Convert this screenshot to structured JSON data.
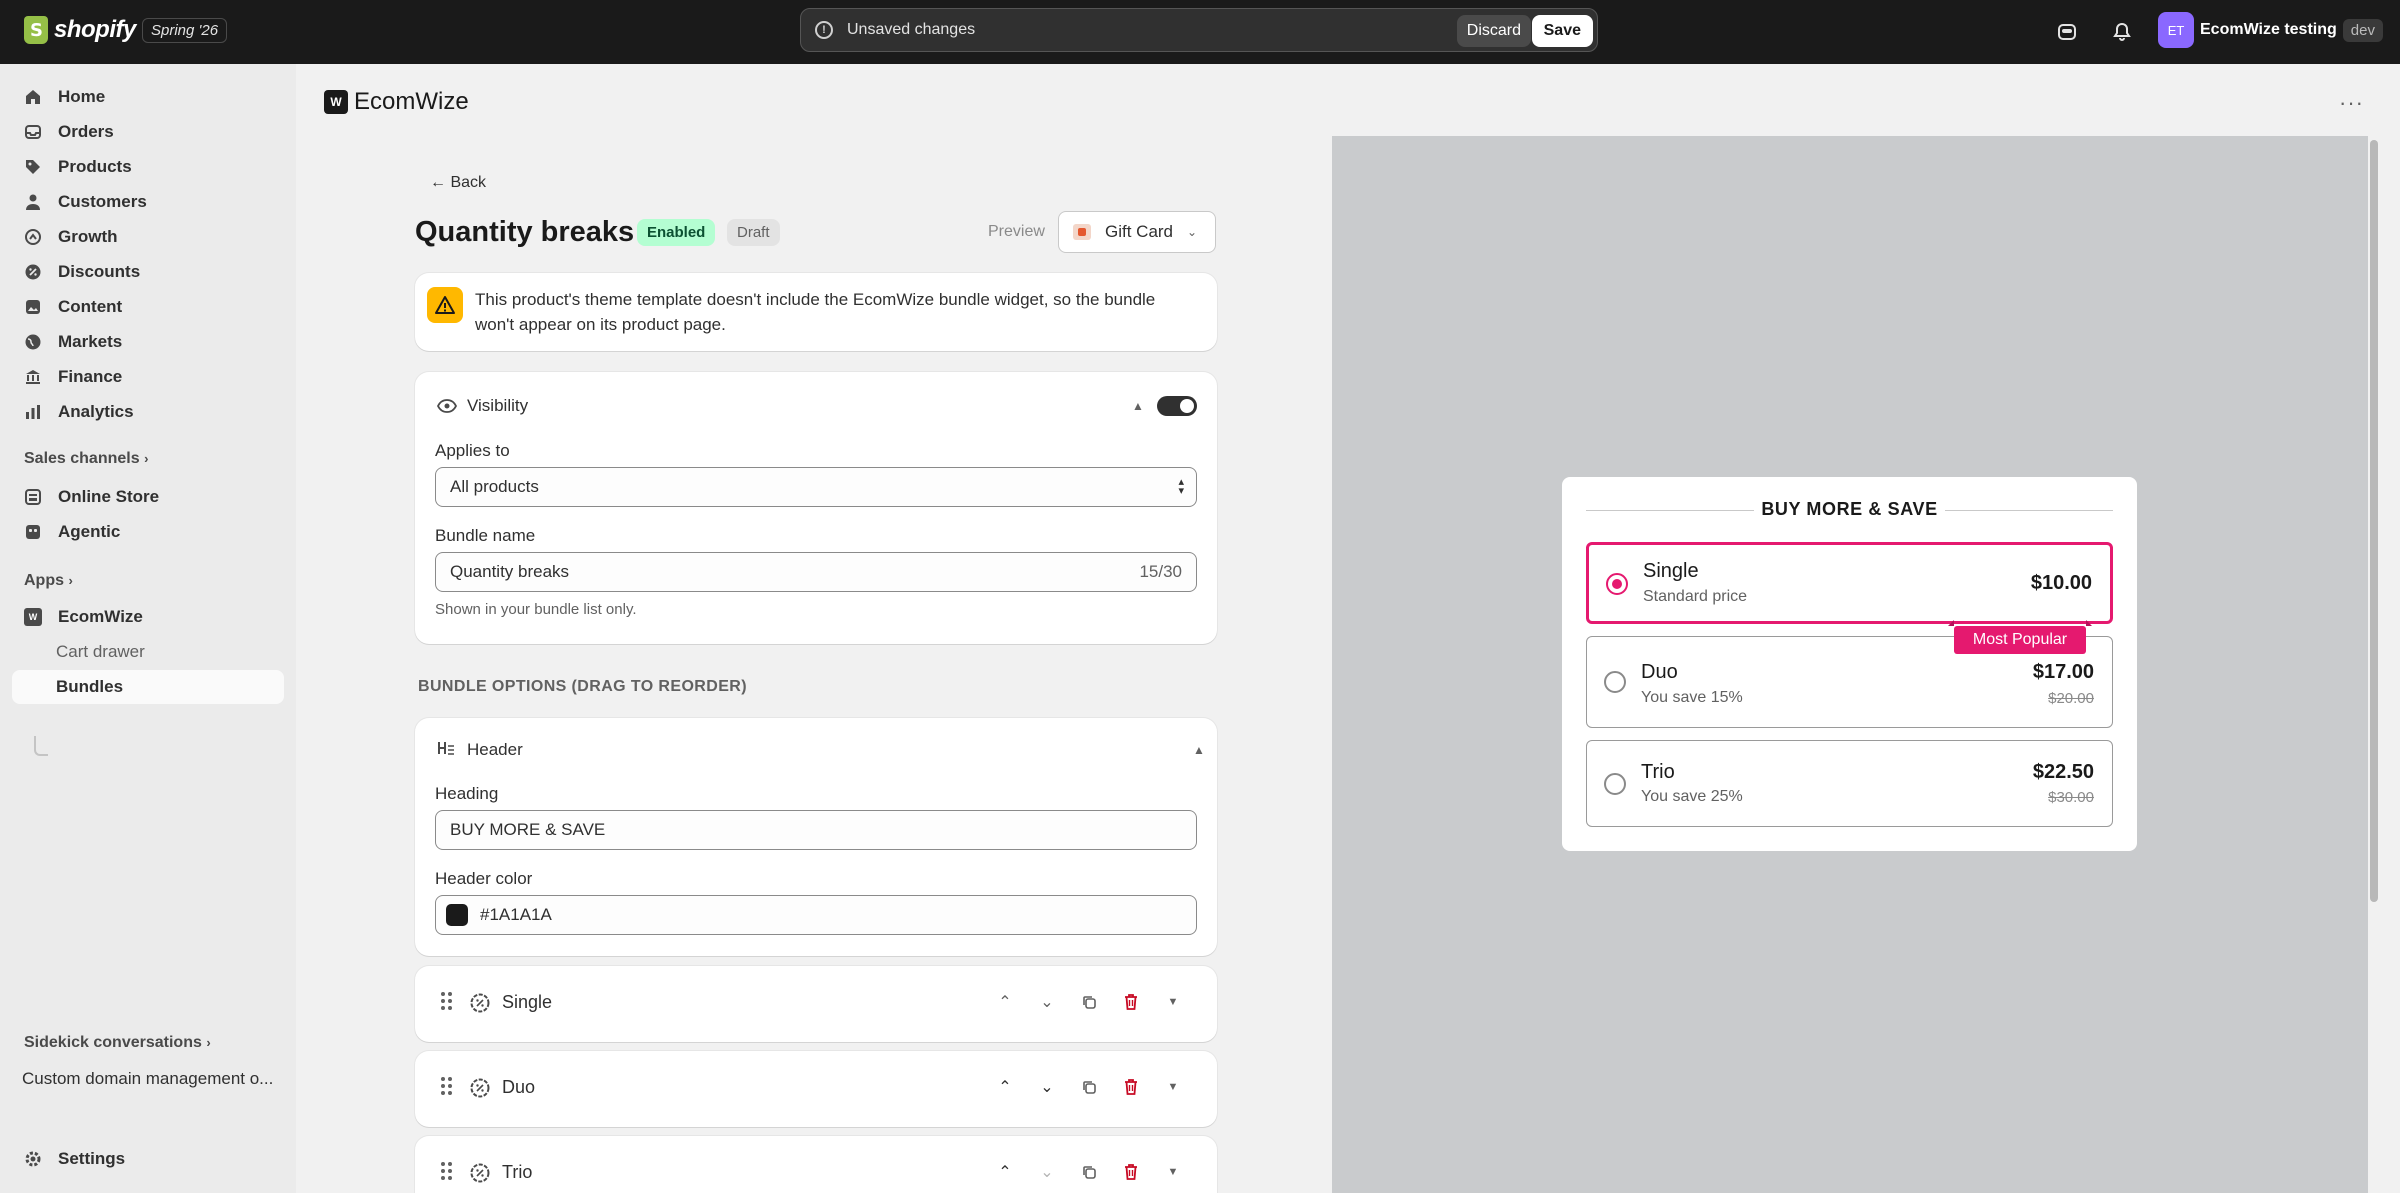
{
  "topbar": {
    "logo_text": "shopify",
    "season": "Spring '26",
    "unsaved_message": "Unsaved changes",
    "discard_label": "Discard",
    "save_label": "Save",
    "avatar_initials": "ET",
    "store_name": "EcomWize testing",
    "store_badge": "dev"
  },
  "sidebar": {
    "items": [
      {
        "label": "Home",
        "icon": "home-icon"
      },
      {
        "label": "Orders",
        "icon": "inbox-icon"
      },
      {
        "label": "Products",
        "icon": "tag-icon"
      },
      {
        "label": "Customers",
        "icon": "person-icon"
      },
      {
        "label": "Growth",
        "icon": "growth-icon"
      },
      {
        "label": "Discounts",
        "icon": "discount-icon"
      },
      {
        "label": "Content",
        "icon": "content-icon"
      },
      {
        "label": "Markets",
        "icon": "globe-icon"
      },
      {
        "label": "Finance",
        "icon": "bank-icon"
      },
      {
        "label": "Analytics",
        "icon": "chart-icon"
      }
    ],
    "sales_channels_label": "Sales channels",
    "channels": [
      {
        "label": "Online Store",
        "icon": "store-icon"
      },
      {
        "label": "Agentic",
        "icon": "agentic-icon"
      }
    ],
    "apps_label": "Apps",
    "app_name": "EcomWize",
    "app_subitems": [
      "Cart drawer",
      "Bundles"
    ],
    "sidekick_label": "Sidekick conversations",
    "sidekick_item": "Custom domain management o...",
    "settings_label": "Settings"
  },
  "app_header": {
    "title": "EcomWize",
    "menu": "···"
  },
  "editor": {
    "back_label": "← Back",
    "page_title": "Quantity breaks",
    "status_enabled": "Enabled",
    "status_draft": "Draft",
    "preview_label": "Preview",
    "preview_product": "Gift Card",
    "alert_text": "This product's theme template doesn't include the EcomWize bundle widget, so the bundle won't appear on its product page.",
    "visibility": {
      "title": "Visibility",
      "applies_to_label": "Applies to",
      "applies_to_value": "All products",
      "bundle_name_label": "Bundle name",
      "bundle_name_value": "Quantity breaks",
      "bundle_name_count": "15/30",
      "bundle_name_help": "Shown in your bundle list only."
    },
    "options_heading": "BUNDLE OPTIONS (DRAG TO REORDER)",
    "header_card": {
      "title": "Header",
      "heading_label": "Heading",
      "heading_value": "BUY MORE & SAVE",
      "color_label": "Header color",
      "color_value": "#1A1A1A"
    },
    "options": [
      {
        "label": "Single"
      },
      {
        "label": "Duo"
      },
      {
        "label": "Trio"
      }
    ]
  },
  "preview": {
    "heading": "BUY MORE & SAVE",
    "accent_color": "#e5196f",
    "tiers": [
      {
        "name": "Single",
        "subtitle": "Standard price",
        "price": "$10.00",
        "old_price": "",
        "selected": true
      },
      {
        "name": "Duo",
        "subtitle": "You save 15%",
        "price": "$17.00",
        "old_price": "$20.00",
        "selected": false
      },
      {
        "name": "Trio",
        "subtitle": "You save 25%",
        "price": "$22.50",
        "old_price": "$30.00",
        "selected": false
      }
    ],
    "badge": "Most Popular"
  }
}
